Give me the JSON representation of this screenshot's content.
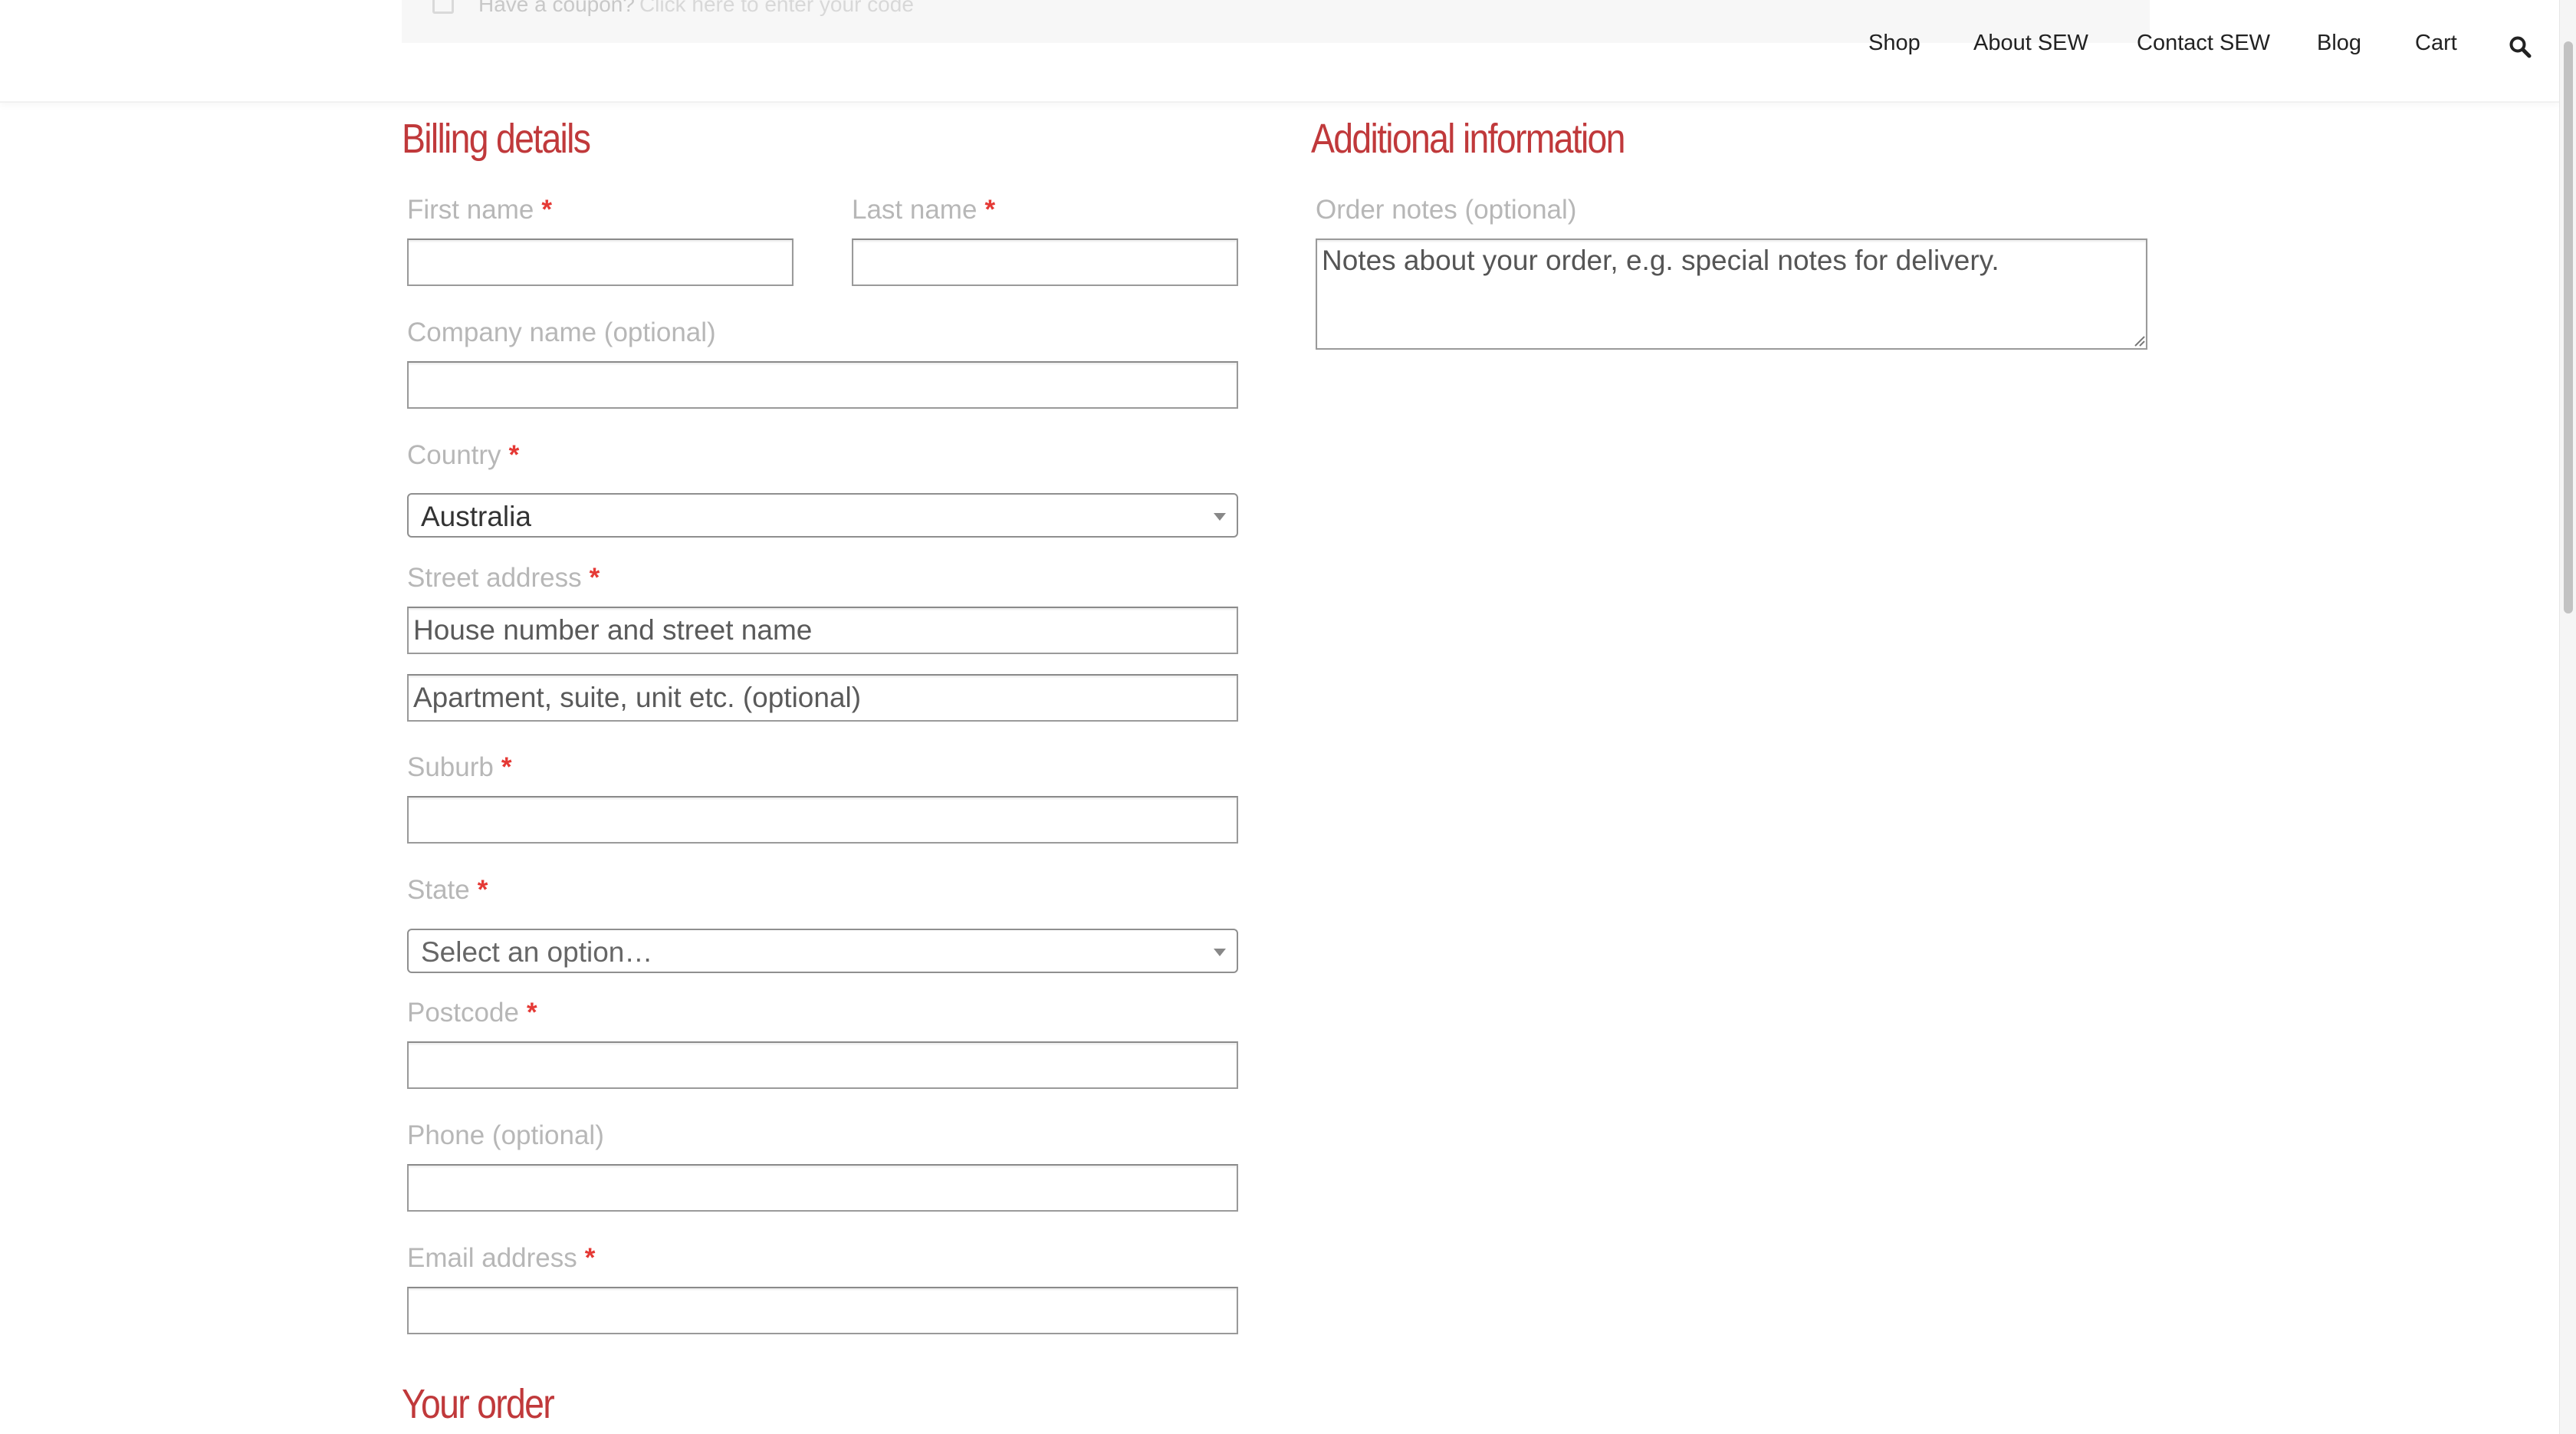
{
  "coupon": {
    "text": "Have a coupon?",
    "link": "Click here to enter your code"
  },
  "nav": {
    "items": [
      "Shop",
      "About SEW",
      "Contact SEW",
      "Blog",
      "Cart"
    ],
    "search_icon": "search-icon"
  },
  "billing": {
    "title": "Billing details",
    "required_marker": "*",
    "first_name": {
      "label": "First name",
      "value": ""
    },
    "last_name": {
      "label": "Last name",
      "value": ""
    },
    "company": {
      "label": "Company name (optional)",
      "value": ""
    },
    "country": {
      "label": "Country",
      "selected": "Australia"
    },
    "street": {
      "label": "Street address",
      "line1_placeholder": "House number and street name",
      "line2_placeholder": "Apartment, suite, unit etc. (optional)"
    },
    "suburb": {
      "label": "Suburb",
      "value": ""
    },
    "state": {
      "label": "State",
      "selected": "Select an option…"
    },
    "postcode": {
      "label": "Postcode",
      "value": ""
    },
    "phone": {
      "label": "Phone (optional)",
      "value": ""
    },
    "email": {
      "label": "Email address",
      "value": ""
    }
  },
  "additional": {
    "title": "Additional information",
    "order_notes": {
      "label": "Order notes (optional)",
      "placeholder": "Notes about your order, e.g. special notes for delivery."
    }
  },
  "order": {
    "title": "Your order"
  },
  "colors": {
    "heading": "#c0393b",
    "required": "#e53935",
    "label": "#b7b7b7"
  }
}
